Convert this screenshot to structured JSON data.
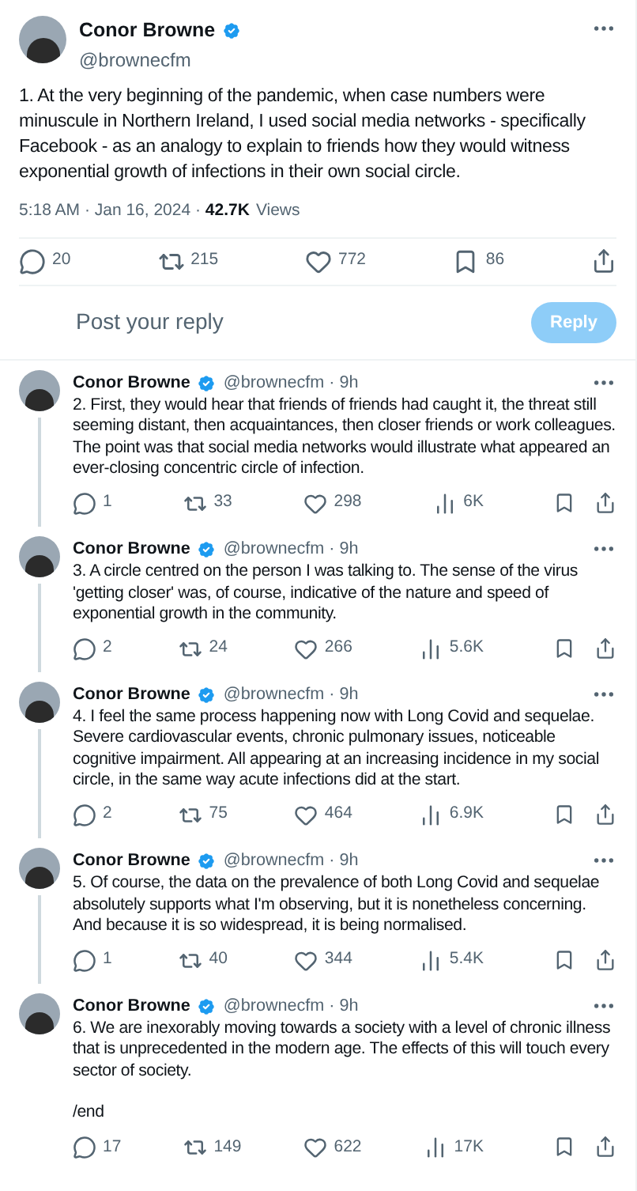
{
  "main_post": {
    "name": "Conor Browne",
    "verified": true,
    "handle": "@brownecfm",
    "text": "1. At the very beginning of the pandemic, when case numbers were minuscule in Northern Ireland, I used social media networks - specifically Facebook -  as an analogy to explain to friends how they would witness exponential growth of infections in their own social circle.",
    "time": "5:18 AM · Jan 16, 2024 · ",
    "views": "42.7K",
    "views_label": "Views",
    "replies": "20",
    "reposts": "215",
    "likes": "772",
    "bookmarks": "86"
  },
  "reply_box": {
    "placeholder": "Post your reply",
    "button": "Reply"
  },
  "thread": [
    {
      "name": "Conor Browne",
      "verified": true,
      "handle": "@brownecfm · 9h",
      "text": "2. First, they would hear that friends of friends had caught it, the threat still seeming distant, then acquaintances, then closer friends or work colleagues. The point was that social media networks would illustrate what appeared an ever-closing concentric circle of infection.",
      "replies": "1",
      "reposts": "33",
      "likes": "298",
      "views": "6K"
    },
    {
      "name": "Conor Browne",
      "verified": true,
      "handle": "@brownecfm · 9h",
      "text": "3. A circle centred on the person I was talking to. The sense of the virus 'getting closer' was, of course, indicative of the nature and speed of exponential growth in the community.",
      "replies": "2",
      "reposts": "24",
      "likes": "266",
      "views": "5.6K"
    },
    {
      "name": "Conor Browne",
      "verified": true,
      "handle": "@brownecfm · 9h",
      "text": "4. I feel the same process happening now with Long Covid and sequelae. Severe cardiovascular events, chronic pulmonary issues, noticeable cognitive impairment. All appearing at an increasing incidence in my social circle, in the same way acute infections did at the start.",
      "replies": "2",
      "reposts": "75",
      "likes": "464",
      "views": "6.9K"
    },
    {
      "name": "Conor Browne",
      "verified": true,
      "handle": "@brownecfm · 9h",
      "text": "5. Of course, the data on the prevalence of both Long Covid and sequelae absolutely supports what I'm observing, but it is nonetheless concerning. And because it is so widespread, it is being normalised.",
      "replies": "1",
      "reposts": "40",
      "likes": "344",
      "views": "5.4K"
    },
    {
      "name": "Conor Browne",
      "verified": true,
      "handle": "@brownecfm · 9h",
      "text": "6. We are inexorably moving towards a society with a level of chronic illness that is unprecedented in the modern age. The effects of this will touch every sector of society.\n\n/end",
      "replies": "17",
      "reposts": "149",
      "likes": "622",
      "views": "17K"
    }
  ]
}
